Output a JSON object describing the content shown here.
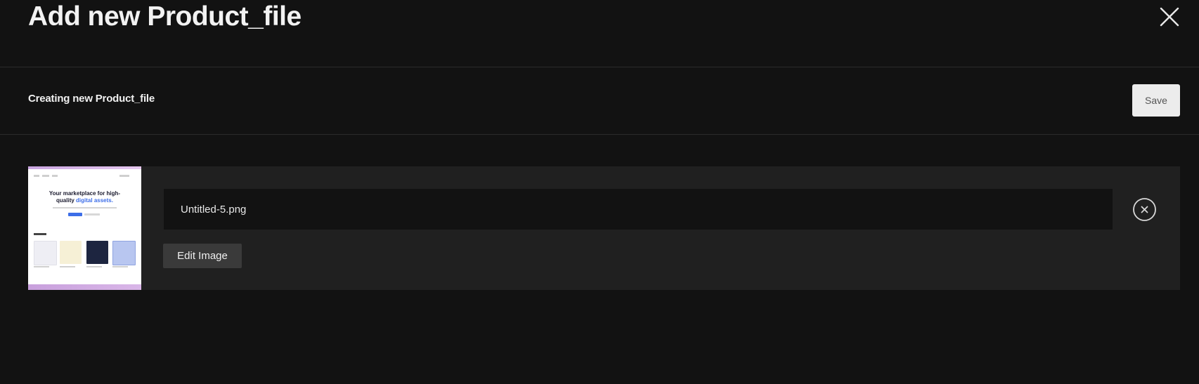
{
  "modal": {
    "title": "Add new Product_file"
  },
  "toolbar": {
    "title": "Creating new Product_file",
    "save_label": "Save"
  },
  "file_item": {
    "filename": "Untitled-5.png",
    "edit_label": "Edit Image",
    "thumbnail": {
      "headline_line1": "Your marketplace for high-",
      "headline_plain": "quality ",
      "headline_accent": "digital assets."
    }
  },
  "icons": {
    "close": "close-icon",
    "remove": "remove-circle-icon"
  },
  "colors": {
    "background": "#121212",
    "panel": "#202020",
    "input": "#121212",
    "save_button": "#ececec",
    "edit_button": "#3a3a3a",
    "thumbnail_accent": "#3d6ee8"
  }
}
